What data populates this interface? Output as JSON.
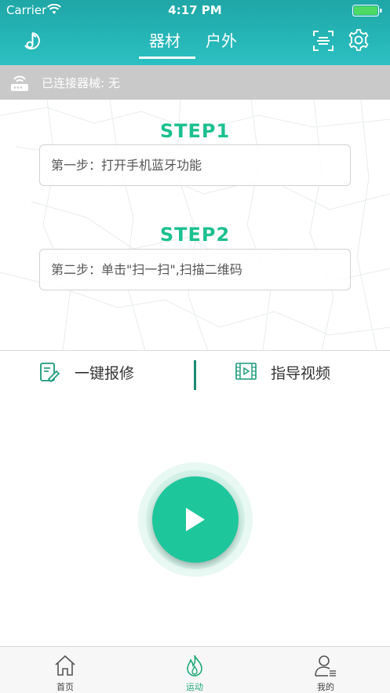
{
  "status_bar": {
    "carrier": "Carrier",
    "time": "4:17 PM"
  },
  "nav": {
    "tabs": [
      {
        "label": "器材",
        "active": true
      },
      {
        "label": "户外",
        "active": false
      }
    ],
    "icons": {
      "left": "music-note-icon",
      "scan": "scan-icon",
      "settings": "gear-icon"
    }
  },
  "device": {
    "label": "已连接器械:  无"
  },
  "steps": [
    {
      "title": "STEP1",
      "text": "第一步：打开手机蓝牙功能"
    },
    {
      "title": "STEP2",
      "text": "第二步：单击\"扫一扫\",扫描二维码"
    }
  ],
  "actions": {
    "repair_label": "一键报修",
    "video_label": "指导视频"
  },
  "tabbar": {
    "items": [
      {
        "label": "首页",
        "icon": "home-icon",
        "active": false
      },
      {
        "label": "运动",
        "icon": "flame-icon",
        "active": true
      },
      {
        "label": "我的",
        "icon": "user-icon",
        "active": false
      }
    ]
  },
  "colors": {
    "header": "#2cc0c2",
    "accent": "#1ec69b",
    "step_title": "#1dc08f",
    "device_bar": "#c9c9c9"
  }
}
